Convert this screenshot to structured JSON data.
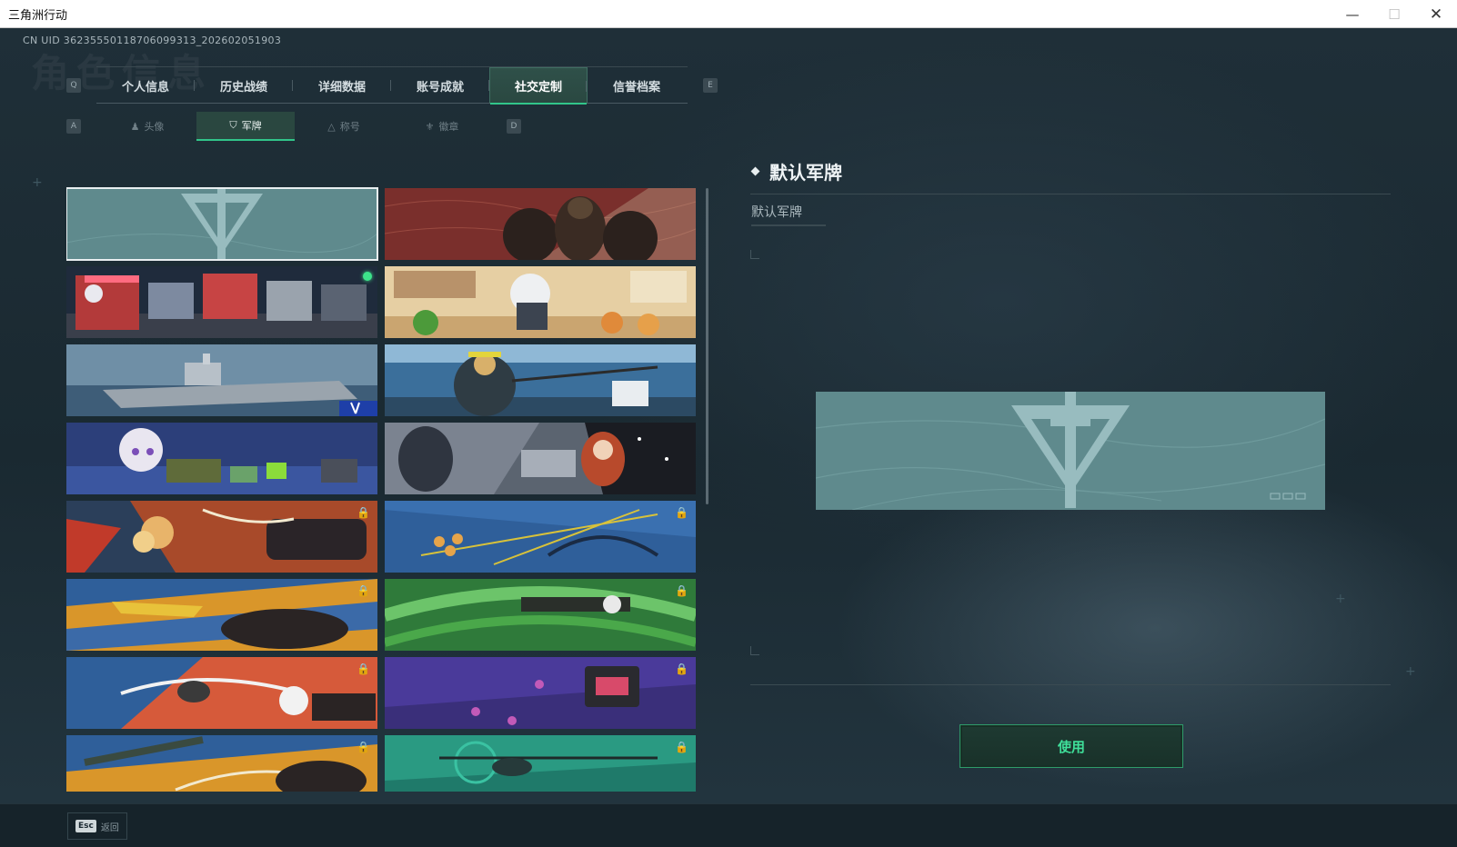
{
  "window": {
    "title": "三角洲行动",
    "minimize": "—",
    "maximize": "☐",
    "close": "✕"
  },
  "uid_text": "CN UID 36235550118706099313_202602051903",
  "background_title": "角色信息",
  "key_hints": {
    "prev_main": "Q",
    "next_main": "E",
    "prev_sub": "A",
    "next_sub": "D"
  },
  "main_tabs": [
    {
      "label": "个人信息",
      "active": false
    },
    {
      "label": "历史战绩",
      "active": false
    },
    {
      "label": "详细数据",
      "active": false
    },
    {
      "label": "账号成就",
      "active": false
    },
    {
      "label": "社交定制",
      "active": true
    },
    {
      "label": "信誉档案",
      "active": false
    }
  ],
  "sub_tabs": [
    {
      "label": "头像",
      "icon": "person-icon",
      "glyph": "♟",
      "active": false
    },
    {
      "label": "军牌",
      "icon": "dogtag-icon",
      "glyph": "⛉",
      "active": true
    },
    {
      "label": "称号",
      "icon": "title-icon",
      "glyph": "△",
      "active": false
    },
    {
      "label": "徽章",
      "icon": "badge-icon",
      "glyph": "⚜",
      "active": false
    }
  ],
  "cards": [
    {
      "id": "default",
      "theme": "default",
      "locked": false,
      "selected": true,
      "equipped": false
    },
    {
      "id": "soldiers-red",
      "theme": "soldiers",
      "locked": false,
      "selected": false,
      "equipped": false
    },
    {
      "id": "pixel-street",
      "theme": "pixel",
      "locked": false,
      "selected": false,
      "equipped": true
    },
    {
      "id": "chibi-kitchen",
      "theme": "kitchen",
      "locked": false,
      "selected": false,
      "equipped": false
    },
    {
      "id": "carrier-sea",
      "theme": "carrier",
      "locked": false,
      "selected": false,
      "equipped": false
    },
    {
      "id": "archer-stadium",
      "theme": "stadium",
      "locked": false,
      "selected": false,
      "equipped": false
    },
    {
      "id": "chibi-loot",
      "theme": "loot",
      "locked": false,
      "selected": false,
      "equipped": false
    },
    {
      "id": "redhead-duo",
      "theme": "duo",
      "locked": false,
      "selected": false,
      "equipped": false
    },
    {
      "id": "explosion",
      "theme": "explosion",
      "locked": true,
      "selected": false,
      "equipped": false
    },
    {
      "id": "blue-bow",
      "theme": "bluebow",
      "locked": true,
      "selected": false,
      "equipped": false
    },
    {
      "id": "orange-launcher",
      "theme": "launcher",
      "locked": true,
      "selected": false,
      "equipped": false
    },
    {
      "id": "green-swirl",
      "theme": "greenswirl",
      "locked": true,
      "selected": false,
      "equipped": false
    },
    {
      "id": "red-drone",
      "theme": "reddrone",
      "locked": true,
      "selected": false,
      "equipped": false
    },
    {
      "id": "purple-paws",
      "theme": "purplepaws",
      "locked": true,
      "selected": false,
      "equipped": false
    },
    {
      "id": "blue-rifle",
      "theme": "bluerifle",
      "locked": true,
      "selected": false,
      "equipped": false
    },
    {
      "id": "teal-heli",
      "theme": "tealheli",
      "locked": true,
      "selected": false,
      "equipped": false
    }
  ],
  "detail": {
    "title": "默认军牌",
    "subtitle": "默认军牌",
    "use_button": "使用"
  },
  "footer": {
    "esc_key": "Esc",
    "esc_label": "返回"
  },
  "colors": {
    "accent": "#31c58a",
    "use_text": "#3fe09a",
    "panel_bg": "#1b2a33"
  }
}
